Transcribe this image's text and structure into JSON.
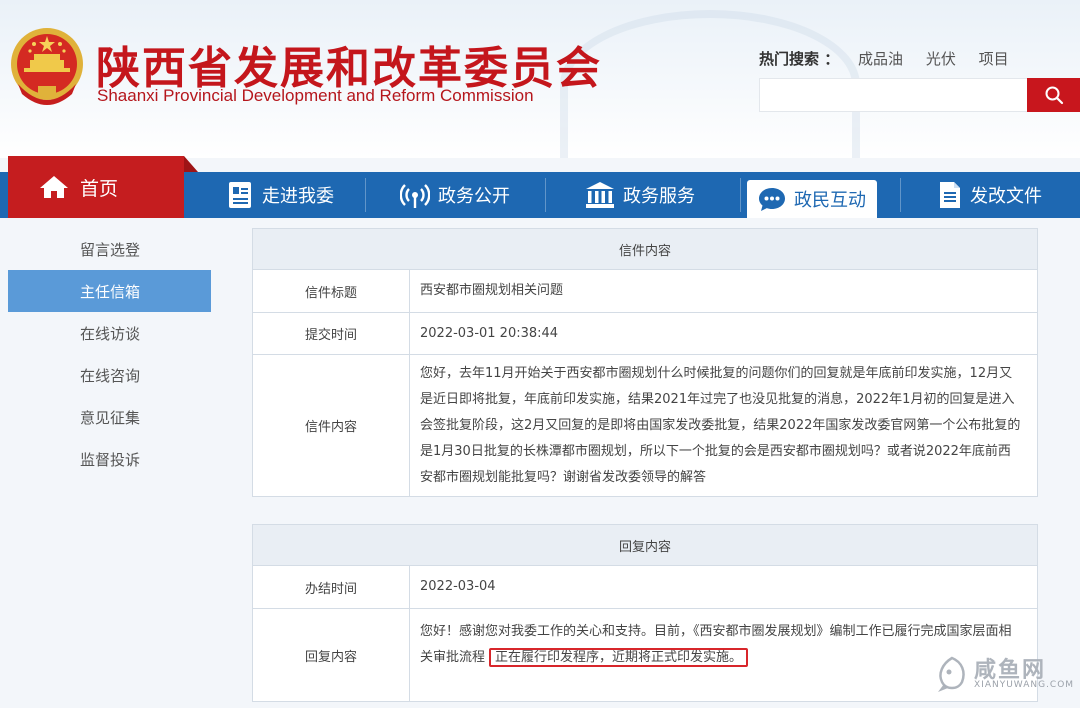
{
  "header": {
    "title": "陕西省发展和改革委员会",
    "subtitle": "Shaanxi Provincial Development and Reform Commission",
    "hot_search_label": "热门搜索 ：",
    "hot_search_items": [
      "成品油",
      "光伏",
      "项目"
    ],
    "search_placeholder": ""
  },
  "nav": {
    "home": "首页",
    "items": [
      {
        "label": "走进我委",
        "icon": "document-person-icon"
      },
      {
        "label": "政务公开",
        "icon": "broadcast-icon"
      },
      {
        "label": "政务服务",
        "icon": "building-icon"
      },
      {
        "label": "政民互动",
        "icon": "chat-bubble-icon",
        "active": true
      },
      {
        "label": "发改文件",
        "icon": "file-icon"
      }
    ]
  },
  "sidebar": {
    "items": [
      {
        "label": "留言选登"
      },
      {
        "label": "主任信箱",
        "active": true
      },
      {
        "label": "在线访谈"
      },
      {
        "label": "在线咨询"
      },
      {
        "label": "意见征集"
      },
      {
        "label": "监督投诉"
      }
    ]
  },
  "letter": {
    "heading": "信件内容",
    "title_label": "信件标题",
    "title_value": "西安都市圈规划相关问题",
    "time_label": "提交时间",
    "time_value": "2022-03-01 20:38:44",
    "content_label": "信件内容",
    "content_value": "您好，去年11月开始关于西安都市圈规划什么时候批复的问题你们的回复就是年底前印发实施，12月又是近日即将批复，年底前印发实施，结果2021年过完了也没见批复的消息，2022年1月初的回复是进入会签批复阶段，这2月又回复的是即将由国家发改委批复，结果2022年国家发改委官网第一个公布批复的是1月30日批复的长株潭都市圈规划，所以下一个批复的会是西安都市圈规划吗？或者说2022年底前西安都市圈规划能批复吗？谢谢省发改委领导的解答"
  },
  "reply": {
    "heading": "回复内容",
    "time_label": "办结时间",
    "time_value": "2022-03-04",
    "content_label": "回复内容",
    "content_value": "您好！感谢您对我委工作的关心和支持。目前，《西安都市圈发展规划》编制工作已履行完成国家层面相关审批流程",
    "content_highlight": "正在履行印发程序，近期将正式印发实施。"
  },
  "watermark": {
    "text": "咸鱼网",
    "sub": "XIANYUWANG.COM"
  },
  "colors": {
    "brand_red": "#c51d1f",
    "nav_blue": "#1e68b2",
    "sidebar_active": "#5a9ad8",
    "highlight_border": "#d8262b"
  }
}
